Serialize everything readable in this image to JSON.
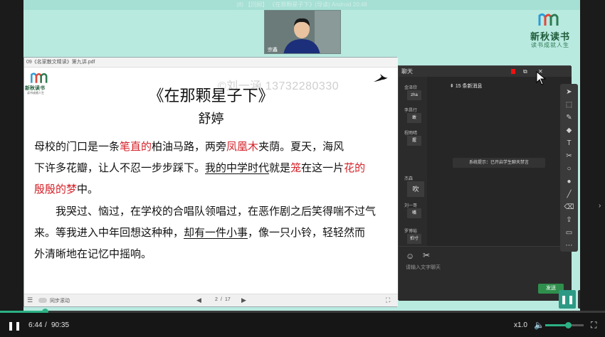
{
  "top_bar": {
    "text": "(8) 【回顾】 《在那颗星子下》(导读)  Android  20:48"
  },
  "brand": {
    "name": "新秋读书",
    "slogan": "读书成就人生",
    "color": "#2e7a52"
  },
  "webcam": {
    "name": "宗鑫"
  },
  "pdf": {
    "filename": "09《名家散文精读》第九讲.pdf",
    "watermark": "©刘一涵 13732280330",
    "logo_name": "新秋读书",
    "logo_slogan": "读书成就人生",
    "heading": "《在那颗星子下》",
    "author": "舒婷",
    "para1_l1": [
      {
        "text": "母校的门口是一条",
        "style": "plain"
      },
      {
        "text": "笔直的",
        "style": "red"
      },
      {
        "text": "柏油马路，两旁",
        "style": "plain"
      },
      {
        "text": "凤凰木",
        "style": "red"
      },
      {
        "text": "夹荫。夏天，海风",
        "style": "plain"
      }
    ],
    "para1_l2": [
      {
        "text": "下",
        "style": "plain"
      },
      {
        "text": "许多花瓣，让人不忍一步步踩下。",
        "style": "plain"
      },
      {
        "text": "我的中学时代",
        "style": "ul"
      },
      {
        "text": "就是",
        "style": "plain"
      },
      {
        "text": "笼",
        "style": "red"
      },
      {
        "text": "在这一片",
        "style": "plain"
      },
      {
        "text": "花的",
        "style": "red"
      }
    ],
    "para1_l3": [
      {
        "text": "殷殷的梦",
        "style": "red"
      },
      {
        "text": "中。",
        "style": "plain"
      }
    ],
    "para2_l1": [
      {
        "text": "我哭过、恼过，在学校的合唱队领唱过，在恶作剧之后笑得喘不过气",
        "style": "plain"
      }
    ],
    "para2_l2": [
      {
        "text": "来。等我进入中年回想这种种，",
        "style": "plain"
      },
      {
        "text": "却有一件小事",
        "style": "ul"
      },
      {
        "text": "，像一只小铃，轻轻然而",
        "style": "plain"
      }
    ],
    "para2_l3": [
      {
        "text": "外清晰地在记忆中摇响。",
        "style": "plain"
      }
    ],
    "sync_label": "同步滚动",
    "page_current": "2",
    "page_total": "17"
  },
  "chat": {
    "title": "聊天",
    "new_messages": "15 条新消息",
    "system_tip": "系统提示：已开启学生聊天禁言",
    "input_placeholder": "请输入文字聊天",
    "send_label": "发送",
    "messages": [
      {
        "user": "金泽欣",
        "text": "zha"
      },
      {
        "user": "李昌行",
        "text": "敢"
      },
      {
        "user": "程雨晴",
        "text": "握"
      },
      {
        "user": "杰森",
        "text": "吹"
      },
      {
        "user": "刘一哥",
        "text": "嘴"
      },
      {
        "user": "罗博裕",
        "text": "拍寸"
      }
    ]
  },
  "toolbar": {
    "items": [
      "pointer-icon",
      "select-icon",
      "pen-icon",
      "eraser-icon",
      "text-icon",
      "scissors-icon",
      "shape-icon",
      "color-icon",
      "line-icon",
      "clear-icon",
      "upload-icon",
      "screen-icon",
      "more-icon"
    ]
  },
  "player": {
    "time_current": "6:44",
    "time_separator": "/",
    "time_total": "90:35",
    "progress": 0.074,
    "speed": "x1.0",
    "volume": 0.6,
    "accent": "#2cb184"
  }
}
